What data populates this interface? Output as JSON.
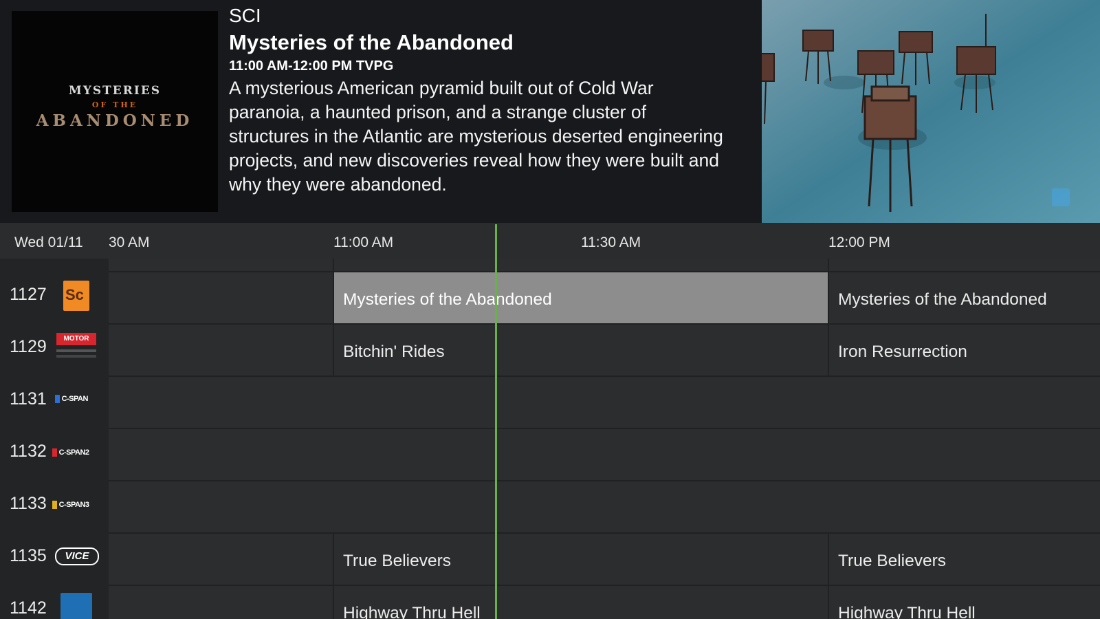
{
  "info": {
    "channel": "SCI",
    "title": "Mysteries of the Abandoned",
    "time": "11:00 AM-12:00 PM TVPG",
    "description": "A mysterious American pyramid built out of Cold War paranoia, a haunted prison, and a strange cluster of structures in the Atlantic are mysterious deserted engineering projects, and new discoveries reveal how they were built and why they were abandoned.",
    "poster": {
      "line1": "MYSTERIES",
      "line2": "OF THE",
      "line3": "ABANDONED"
    }
  },
  "timeline": {
    "date": "Wed 01/11",
    "times": [
      "30 AM",
      "11:00 AM",
      "11:30 AM",
      "12:00 PM"
    ]
  },
  "channels": [
    {
      "number": "1127",
      "logo": "science-logo",
      "logo_text": "Sc"
    },
    {
      "number": "1129",
      "logo": "motortrend-logo",
      "logo_text": "MOTOR"
    },
    {
      "number": "1131",
      "logo": "cspan-logo",
      "logo_text": "C-SPAN"
    },
    {
      "number": "1132",
      "logo": "cspan2-logo",
      "logo_text": "C-SPAN2"
    },
    {
      "number": "1133",
      "logo": "cspan3-logo",
      "logo_text": "C-SPAN3"
    },
    {
      "number": "1135",
      "logo": "vice-logo",
      "logo_text": "VICE"
    },
    {
      "number": "1142",
      "logo": "channel-logo",
      "logo_text": ""
    }
  ],
  "programs": {
    "row_1127": [
      "Mysteries of the Abandoned",
      "Mysteries of the Abandoned"
    ],
    "row_1129": [
      "Bitchin' Rides",
      "Iron Resurrection"
    ],
    "row_1135": [
      "True Believers",
      "True Believers"
    ],
    "row_1142": [
      "Highway Thru Hell",
      "Highway Thru Hell"
    ]
  },
  "colors": {
    "now_line": "#6ab04c",
    "selected_cell": "#8d8d8d",
    "science_orange": "#f08a24",
    "motortrend_red": "#d8262e",
    "cspan_blue": "#2a6fd4"
  }
}
